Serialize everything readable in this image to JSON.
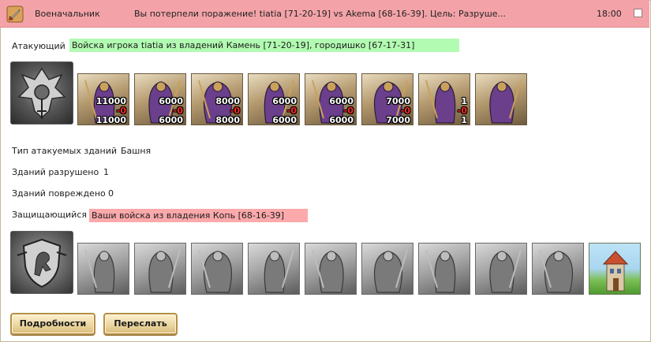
{
  "message": {
    "sender": "Военачальник",
    "subject": "Вы потерпели поражение! tiatia [71-20-19] vs Akema [68-16-39]. Цель: Разруше...",
    "time": "18:00"
  },
  "colors": {
    "header_bg": "#f3a3a8",
    "attacker_highlight": "#b2fbb2",
    "defender_highlight": "#fba9ab",
    "button_bg": "#ecd7a2",
    "loss_text": "#ff2a2a"
  },
  "attacker": {
    "label": "Атакующий",
    "description": "Войска игрока tiatia из владений Камень [71-20-19], городишко [67-17-31]",
    "hero_icon": "dark-hero-emblem-icon",
    "units": [
      {
        "icon": "orc-brute-icon",
        "total": "11000",
        "lost": "-0",
        "remaining": "11000"
      },
      {
        "icon": "assassin-icon",
        "total": "6000",
        "lost": "-0",
        "remaining": "6000"
      },
      {
        "icon": "armored-spearman-icon",
        "total": "8000",
        "lost": "-0",
        "remaining": "8000"
      },
      {
        "icon": "harpy-icon",
        "total": "6000",
        "lost": "-0",
        "remaining": "6000"
      },
      {
        "icon": "archer-icon",
        "total": "6000",
        "lost": "-0",
        "remaining": "6000"
      },
      {
        "icon": "sorcerer-icon",
        "total": "7000",
        "lost": "-0",
        "remaining": "7000"
      },
      {
        "icon": "dark-knight-icon",
        "total": "1",
        "lost": "-0",
        "remaining": "1"
      },
      {
        "icon": "reaper-icon",
        "total": "",
        "lost": "",
        "remaining": ""
      }
    ]
  },
  "stats": {
    "building_type_label": "Тип атакуемых зданий",
    "building_type_value": "Башня",
    "destroyed_label": "Зданий разрушено",
    "destroyed_value": "1",
    "damaged_label": "Зданий повреждено",
    "damaged_value": "0"
  },
  "defender": {
    "label": "Защищающийся",
    "description": "Ваши войска из владения Копь [68-16-39]",
    "hero_icon": "lion-crest-emblem-icon",
    "units": [
      {
        "icon": "armored-beast-icon"
      },
      {
        "icon": "mace-warrior-icon"
      },
      {
        "icon": "pikeman-icon"
      },
      {
        "icon": "cavalry-knight-icon"
      },
      {
        "icon": "griffin-icon"
      },
      {
        "icon": "crossbowman-icon"
      },
      {
        "icon": "hooded-monk-icon"
      },
      {
        "icon": "swordsman-icon"
      },
      {
        "icon": "wraith-icon"
      },
      {
        "icon": "watchtower-icon"
      }
    ]
  },
  "buttons": {
    "details": "Подробности",
    "forward": "Переслать"
  }
}
